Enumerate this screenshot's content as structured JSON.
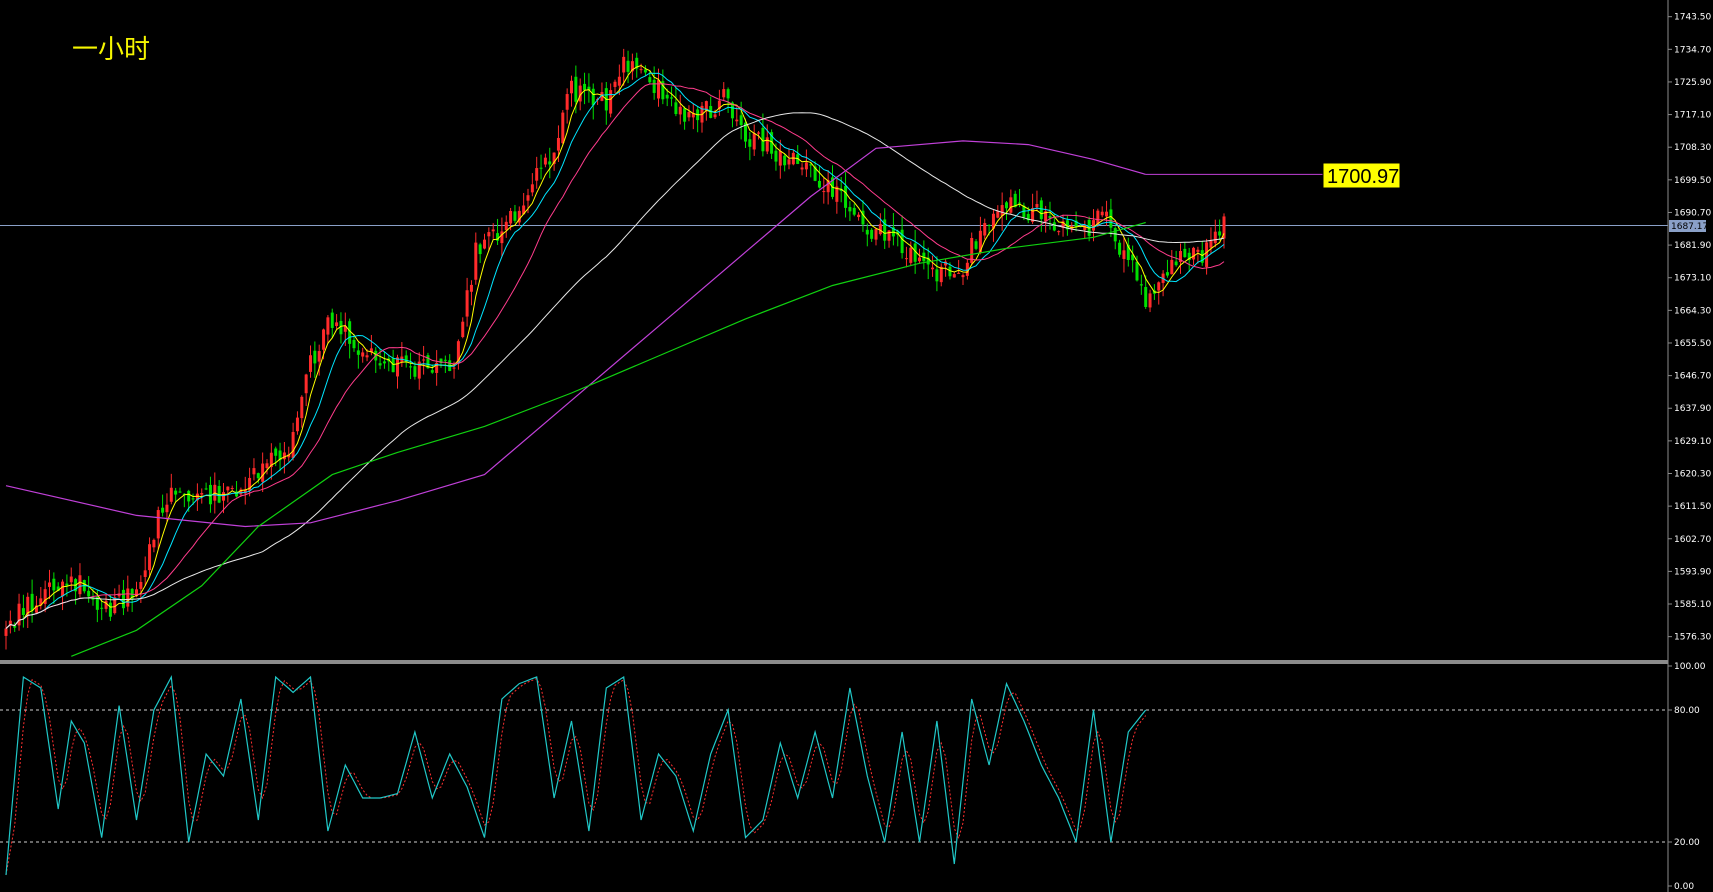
{
  "title": "一小时",
  "colors": {
    "background": "#000000",
    "bull": "#ff2b2b",
    "bear": "#00e000",
    "ma_yellow": "#ffff00",
    "ma_cyan": "#00e5ff",
    "ma_pink": "#ff3c8c",
    "ma_white": "#e8e8e8",
    "ma_magenta": "#c040d8",
    "ma_green": "#10d010",
    "current_price_line": "#8aa0c8",
    "stoch_main": "#20c8c8",
    "stoch_signal": "#ff3030"
  },
  "price_axis": {
    "min": 1570,
    "max": 1748,
    "ticks": [
      "1743.50",
      "1734.70",
      "1725.90",
      "1717.10",
      "1708.30",
      "1699.50",
      "1690.70",
      "1681.90",
      "1673.10",
      "1664.30",
      "1655.50",
      "1646.70",
      "1637.90",
      "1629.10",
      "1620.30",
      "1611.50",
      "1602.70",
      "1593.90",
      "1585.10",
      "1576.30"
    ]
  },
  "current_price": "1687.17",
  "callout_value": "1700.97",
  "osc_axis": {
    "ticks": [
      "100.00",
      "80.00",
      "20.00",
      "0.00"
    ],
    "levels": [
      80,
      20
    ]
  },
  "chart_data": {
    "type": "candlestick",
    "title": "一小时",
    "price_range": [
      1570,
      1748
    ],
    "bars_count": 196,
    "close_anchors": [
      [
        0,
        1578
      ],
      [
        5,
        1585
      ],
      [
        10,
        1590
      ],
      [
        15,
        1592
      ],
      [
        20,
        1587
      ],
      [
        25,
        1584
      ],
      [
        30,
        1590
      ],
      [
        38,
        1618
      ],
      [
        45,
        1614
      ],
      [
        52,
        1616
      ],
      [
        58,
        1622
      ],
      [
        65,
        1628
      ],
      [
        70,
        1650
      ],
      [
        75,
        1662
      ],
      [
        82,
        1654
      ],
      [
        88,
        1650
      ],
      [
        95,
        1649
      ],
      [
        103,
        1648
      ],
      [
        108,
        1680
      ],
      [
        115,
        1687
      ],
      [
        120,
        1697
      ],
      [
        125,
        1705
      ],
      [
        130,
        1724
      ],
      [
        138,
        1720
      ],
      [
        142,
        1732
      ],
      [
        148,
        1726
      ],
      [
        155,
        1718
      ],
      [
        160,
        1717
      ],
      [
        165,
        1722
      ],
      [
        170,
        1712
      ],
      [
        178,
        1706
      ],
      [
        185,
        1702
      ],
      [
        190,
        1697
      ],
      [
        196,
        1688
      ],
      [
        205,
        1682
      ],
      [
        212,
        1674
      ],
      [
        220,
        1676
      ],
      [
        224,
        1686
      ],
      [
        230,
        1693
      ],
      [
        240,
        1689
      ],
      [
        248,
        1686
      ],
      [
        252,
        1690
      ],
      [
        260,
        1674
      ],
      [
        262,
        1665
      ],
      [
        268,
        1678
      ],
      [
        275,
        1680
      ],
      [
        280,
        1687
      ]
    ],
    "moving_averages": [
      {
        "color": "#ffff00",
        "period": 5
      },
      {
        "color": "#00e5ff",
        "period": 10
      },
      {
        "color": "#ff3c8c",
        "period": 20
      },
      {
        "color": "#e8e8e8",
        "period": 60
      }
    ],
    "slow_lines": [
      {
        "name": "magenta",
        "points": [
          [
            0,
            1617
          ],
          [
            30,
            1609
          ],
          [
            55,
            1606
          ],
          [
            70,
            1607
          ],
          [
            90,
            1613
          ],
          [
            110,
            1620
          ],
          [
            130,
            1640
          ],
          [
            150,
            1660
          ],
          [
            170,
            1680
          ],
          [
            185,
            1695
          ],
          [
            200,
            1708
          ],
          [
            220,
            1710
          ],
          [
            235,
            1709
          ],
          [
            250,
            1705
          ],
          [
            262,
            1700.97
          ]
        ]
      },
      {
        "name": "green",
        "points": [
          [
            15,
            1571
          ],
          [
            30,
            1578
          ],
          [
            45,
            1590
          ],
          [
            58,
            1606
          ],
          [
            75,
            1620
          ],
          [
            90,
            1626
          ],
          [
            110,
            1633
          ],
          [
            130,
            1642
          ],
          [
            150,
            1652
          ],
          [
            170,
            1662
          ],
          [
            190,
            1671
          ],
          [
            210,
            1677
          ],
          [
            230,
            1681
          ],
          [
            250,
            1684
          ],
          [
            262,
            1688
          ]
        ]
      }
    ],
    "stochastic": {
      "range": [
        0,
        100
      ],
      "levels": [
        80,
        20
      ],
      "k_anchors": [
        [
          0,
          5
        ],
        [
          4,
          95
        ],
        [
          8,
          90
        ],
        [
          12,
          35
        ],
        [
          15,
          75
        ],
        [
          18,
          65
        ],
        [
          22,
          22
        ],
        [
          26,
          82
        ],
        [
          30,
          30
        ],
        [
          34,
          80
        ],
        [
          38,
          95
        ],
        [
          42,
          20
        ],
        [
          46,
          60
        ],
        [
          50,
          50
        ],
        [
          54,
          85
        ],
        [
          58,
          30
        ],
        [
          62,
          95
        ],
        [
          66,
          88
        ],
        [
          70,
          95
        ],
        [
          74,
          25
        ],
        [
          78,
          55
        ],
        [
          82,
          40
        ],
        [
          86,
          40
        ],
        [
          90,
          42
        ],
        [
          94,
          70
        ],
        [
          98,
          40
        ],
        [
          102,
          60
        ],
        [
          106,
          45
        ],
        [
          110,
          22
        ],
        [
          114,
          85
        ],
        [
          118,
          92
        ],
        [
          122,
          95
        ],
        [
          126,
          40
        ],
        [
          130,
          75
        ],
        [
          134,
          25
        ],
        [
          138,
          90
        ],
        [
          142,
          95
        ],
        [
          146,
          30
        ],
        [
          150,
          60
        ],
        [
          154,
          50
        ],
        [
          158,
          25
        ],
        [
          162,
          60
        ],
        [
          166,
          80
        ],
        [
          170,
          22
        ],
        [
          174,
          30
        ],
        [
          178,
          65
        ],
        [
          182,
          40
        ],
        [
          186,
          70
        ],
        [
          190,
          40
        ],
        [
          194,
          90
        ],
        [
          198,
          50
        ],
        [
          202,
          20
        ],
        [
          206,
          70
        ],
        [
          210,
          20
        ],
        [
          214,
          75
        ],
        [
          218,
          10
        ],
        [
          222,
          85
        ],
        [
          226,
          55
        ],
        [
          230,
          92
        ],
        [
          234,
          75
        ],
        [
          238,
          55
        ],
        [
          242,
          40
        ],
        [
          246,
          20
        ],
        [
          250,
          80
        ],
        [
          254,
          20
        ],
        [
          258,
          70
        ],
        [
          262,
          80
        ]
      ]
    }
  }
}
